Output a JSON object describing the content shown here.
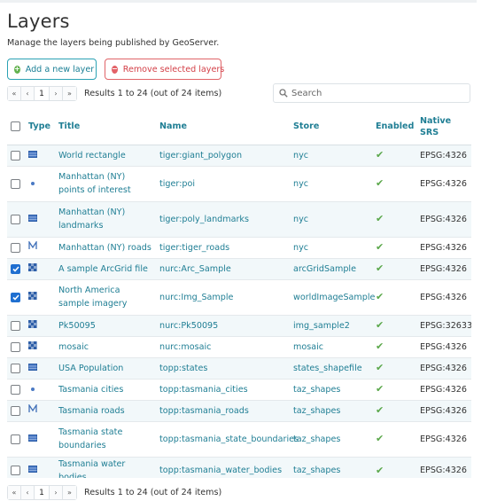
{
  "page": {
    "title": "Layers",
    "subtitle": "Manage the layers being published by GeoServer."
  },
  "actions": {
    "add_label": "Add a new layer",
    "remove_label": "Remove selected layers"
  },
  "pager": {
    "first": "«",
    "prev": "‹",
    "page": "1",
    "next": "›",
    "last": "»",
    "results_text": "Results 1 to 24 (out of 24 items)"
  },
  "search": {
    "placeholder": "Search",
    "value": ""
  },
  "colors": {
    "link": "#1f7e94",
    "row_alt": "#f2f8fa",
    "enabled_check": "#5aa74a",
    "add_accent": "#63b24f",
    "remove_accent": "#e36268",
    "checkbox_selected": "#1f6fd0"
  },
  "table": {
    "headers": {
      "type": "Type",
      "title": "Title",
      "name": "Name",
      "store": "Store",
      "enabled": "Enabled",
      "srs": "Native SRS"
    },
    "rows": [
      {
        "selected": false,
        "type": "polygon-icon",
        "title": "World rectangle",
        "name": "tiger:giant_polygon",
        "store": "nyc",
        "enabled": "✔",
        "srs": "EPSG:4326"
      },
      {
        "selected": false,
        "type": "point-icon",
        "title": "Manhattan (NY) points of interest",
        "name": "tiger:poi",
        "store": "nyc",
        "enabled": "✔",
        "srs": "EPSG:4326"
      },
      {
        "selected": false,
        "type": "polygon-icon",
        "title": "Manhattan (NY) landmarks",
        "name": "tiger:poly_landmarks",
        "store": "nyc",
        "enabled": "✔",
        "srs": "EPSG:4326"
      },
      {
        "selected": false,
        "type": "line-icon",
        "title": "Manhattan (NY) roads",
        "name": "tiger:tiger_roads",
        "store": "nyc",
        "enabled": "✔",
        "srs": "EPSG:4326"
      },
      {
        "selected": true,
        "type": "raster-icon",
        "title": "A sample ArcGrid file",
        "name": "nurc:Arc_Sample",
        "store": "arcGridSample",
        "enabled": "✔",
        "srs": "EPSG:4326"
      },
      {
        "selected": true,
        "type": "raster-icon",
        "title": "North America sample imagery",
        "name": "nurc:Img_Sample",
        "store": "worldImageSample",
        "enabled": "✔",
        "srs": "EPSG:4326"
      },
      {
        "selected": false,
        "type": "raster-icon",
        "title": "Pk50095",
        "name": "nurc:Pk50095",
        "store": "img_sample2",
        "enabled": "✔",
        "srs": "EPSG:32633"
      },
      {
        "selected": false,
        "type": "raster-icon",
        "title": "mosaic",
        "name": "nurc:mosaic",
        "store": "mosaic",
        "enabled": "✔",
        "srs": "EPSG:4326"
      },
      {
        "selected": false,
        "type": "polygon-icon",
        "title": "USA Population",
        "name": "topp:states",
        "store": "states_shapefile",
        "enabled": "✔",
        "srs": "EPSG:4326"
      },
      {
        "selected": false,
        "type": "point-icon",
        "title": "Tasmania cities",
        "name": "topp:tasmania_cities",
        "store": "taz_shapes",
        "enabled": "✔",
        "srs": "EPSG:4326"
      },
      {
        "selected": false,
        "type": "line-icon",
        "title": "Tasmania roads",
        "name": "topp:tasmania_roads",
        "store": "taz_shapes",
        "enabled": "✔",
        "srs": "EPSG:4326"
      },
      {
        "selected": false,
        "type": "polygon-icon",
        "title": "Tasmania state boundaries",
        "name": "topp:tasmania_state_boundaries",
        "store": "taz_shapes",
        "enabled": "✔",
        "srs": "EPSG:4326"
      },
      {
        "selected": false,
        "type": "polygon-icon",
        "title": "Tasmania water bodies",
        "name": "topp:tasmania_water_bodies",
        "store": "taz_shapes",
        "enabled": "✔",
        "srs": "EPSG:4326"
      }
    ]
  }
}
